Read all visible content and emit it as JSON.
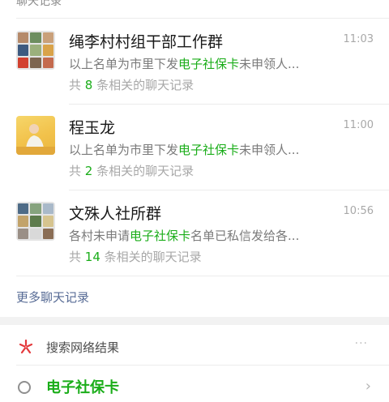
{
  "section": {
    "header": "聊天记录"
  },
  "results": [
    {
      "title": "绳李村村组干部工作群",
      "time": "11:03",
      "snippet_prefix": "以上名单为市里下发",
      "snippet_keyword": "电子社保卡",
      "snippet_suffix": "未申领人...",
      "count_prefix": "共",
      "count": "8",
      "count_suffix": "条相关的聊天记录",
      "avatar": "group"
    },
    {
      "title": "程玉龙",
      "time": "11:00",
      "snippet_prefix": "以上名单为市里下发",
      "snippet_keyword": "电子社保卡",
      "snippet_suffix": "未申领人...",
      "count_prefix": "共",
      "count": "2",
      "count_suffix": "条相关的聊天记录",
      "avatar": "single"
    },
    {
      "title": "文殊人社所群",
      "time": "10:56",
      "snippet_prefix": "各村未申请",
      "snippet_keyword": "电子社保卡",
      "snippet_suffix": "名单已私信发给各...",
      "count_prefix": "共",
      "count": "14",
      "count_suffix": "条相关的聊天记录",
      "avatar": "group"
    }
  ],
  "more_link": "更多聊天记录",
  "web_search": {
    "label": "搜索网络结果",
    "icon": "search-web-icon",
    "more": "···"
  },
  "suggestion": {
    "label": "电子社保卡",
    "icon": "search-icon"
  },
  "colors": {
    "highlight": "#1aad19",
    "link": "#576b95",
    "text": "#191919",
    "muted": "#a8a8a8"
  }
}
